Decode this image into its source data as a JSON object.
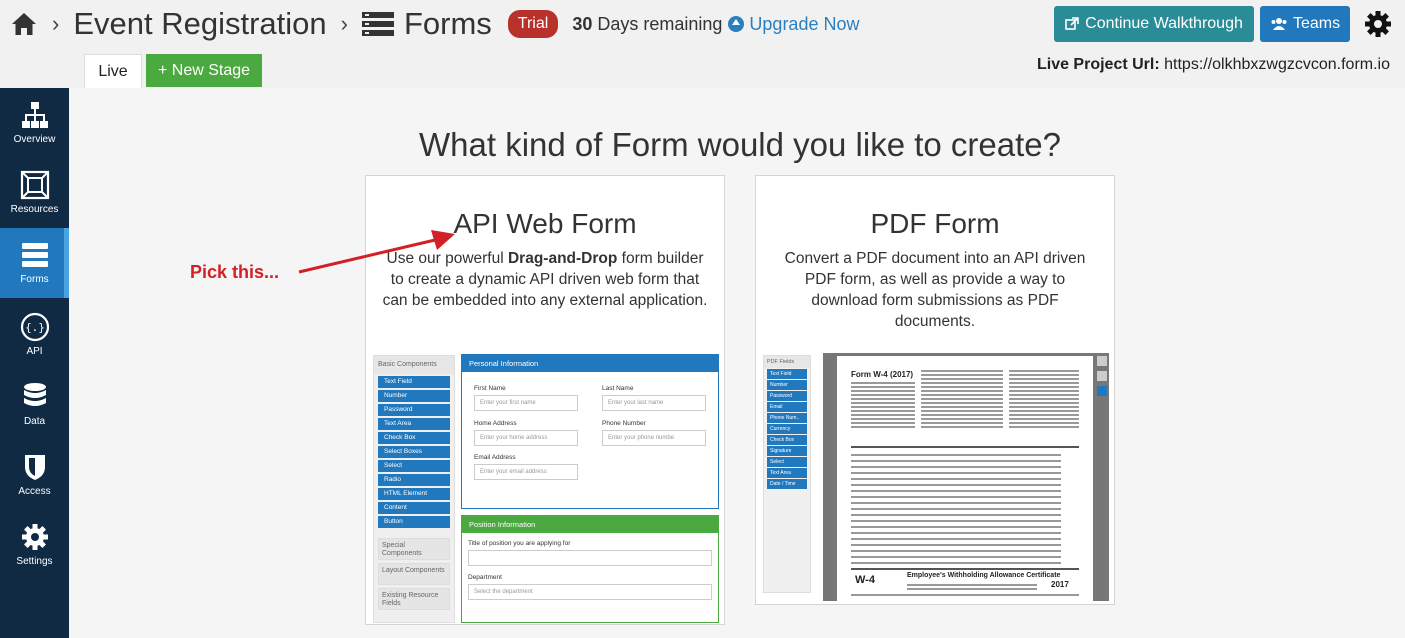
{
  "header": {
    "breadcrumb_project": "Event Registration",
    "breadcrumb_section": "Forms",
    "trial_badge": "Trial",
    "days_count": "30",
    "days_text": "Days remaining",
    "upgrade_label": "Upgrade Now",
    "walkthrough_label": "Continue Walkthrough",
    "teams_label": "Teams",
    "tab_live": "Live",
    "new_stage_label": "+ New Stage",
    "live_url_label": "Live Project Url:",
    "live_url_value": "https://olkhbxzwgzcvcon.form.io"
  },
  "sidebar": {
    "items": [
      {
        "label": "Overview",
        "icon": "sitemap-icon"
      },
      {
        "label": "Resources",
        "icon": "resources-icon"
      },
      {
        "label": "Forms",
        "icon": "forms-icon",
        "active": true
      },
      {
        "label": "API",
        "icon": "api-icon"
      },
      {
        "label": "Data",
        "icon": "database-icon"
      },
      {
        "label": "Access",
        "icon": "shield-icon"
      },
      {
        "label": "Settings",
        "icon": "gear-icon"
      }
    ]
  },
  "main": {
    "title": "What kind of Form would you like to create?",
    "api_card": {
      "title": "API Web Form",
      "desc_pre": "Use our powerful ",
      "desc_bold": "Drag-and-Drop",
      "desc_post": " form builder to create a dynamic API driven web form that can be embedded into any external application."
    },
    "pdf_card": {
      "title": "PDF Form",
      "desc": "Convert a PDF document into an API driven PDF form, as well as provide a way to download form submissions as PDF documents."
    },
    "annotation": "Pick this..."
  },
  "api_preview": {
    "basic_components": "Basic Components",
    "components": [
      "Text Field",
      "Number",
      "Password",
      "Text Area",
      "Check Box",
      "Select Boxes",
      "Select",
      "Radio",
      "HTML Element",
      "Content",
      "Button"
    ],
    "sections": [
      "Special Components",
      "Layout Components",
      "Existing Resource Fields"
    ],
    "personal_info": "Personal Information",
    "first_name": "First Name",
    "first_name_ph": "Enter your first name",
    "last_name": "Last Name",
    "last_name_ph": "Enter your last name",
    "home_address": "Home Address",
    "home_address_ph": "Enter your home address",
    "phone_number": "Phone Number",
    "phone_number_ph": "Enter your phone numbe",
    "email_address": "Email Address",
    "email_address_ph": "Enter your email address",
    "position_info": "Position Information",
    "position_title": "Title of position you are applying for",
    "department": "Department",
    "department_ph": "Select the department"
  },
  "pdf_preview": {
    "fields_head": "PDF Fields",
    "fields": [
      "Text Field",
      "Number",
      "Password",
      "Email",
      "Phone Num..",
      "Currency",
      "Check Box",
      "Signature",
      "Select",
      "Text Area",
      "Date / Time"
    ],
    "form_title": "Form W-4 (2017)",
    "w4": "W-4",
    "certificate": "Employee's Withholding Allowance Certificate",
    "year": "2017"
  }
}
